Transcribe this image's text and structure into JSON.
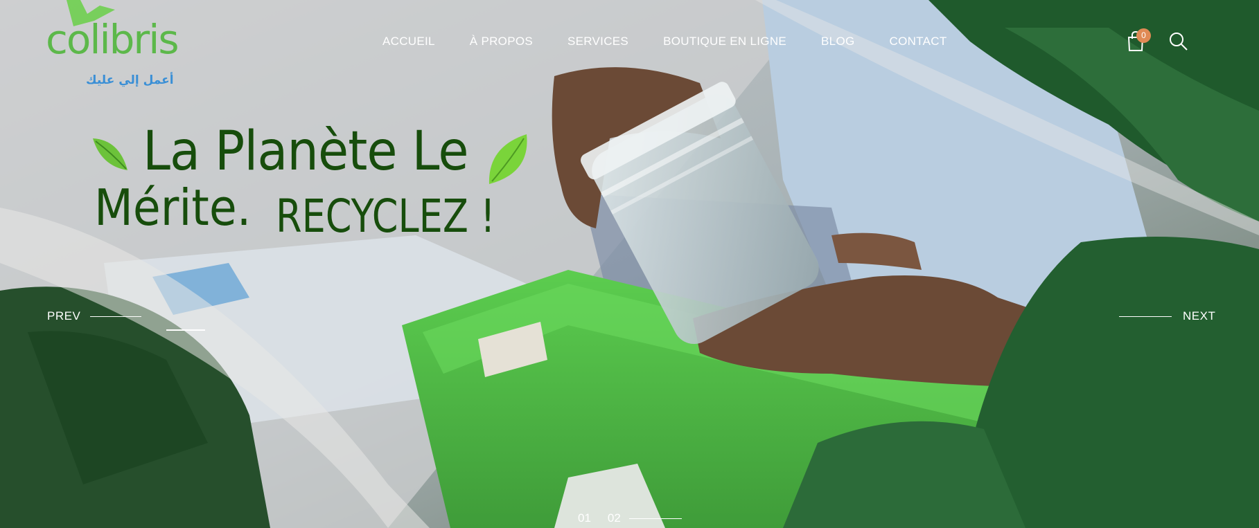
{
  "brand": {
    "name": "colibris",
    "tagline": "أعمل إلي عليك"
  },
  "nav": {
    "items": [
      {
        "label": "ACCUEIL"
      },
      {
        "label": "À PROPOS"
      },
      {
        "label": "SERVICES"
      },
      {
        "label": "BOUTIQUE EN LIGNE"
      },
      {
        "label": "BLOG"
      },
      {
        "label": "CONTACT"
      }
    ]
  },
  "header": {
    "cart_icon": "shopping-bag-icon",
    "cart_count": "0",
    "search_icon": "search-icon"
  },
  "hero": {
    "line1": "La Planète Le",
    "line2": "Mérite.",
    "line3": "RECYCLEZ !"
  },
  "slider": {
    "prev_label": "PREV",
    "next_label": "NEXT",
    "pages": [
      "01",
      "02"
    ]
  },
  "colors": {
    "brand_green": "#5cb84a",
    "title_green": "#174d0c",
    "badge": "#e08a55",
    "tagline_blue": "#3a8fd6"
  }
}
